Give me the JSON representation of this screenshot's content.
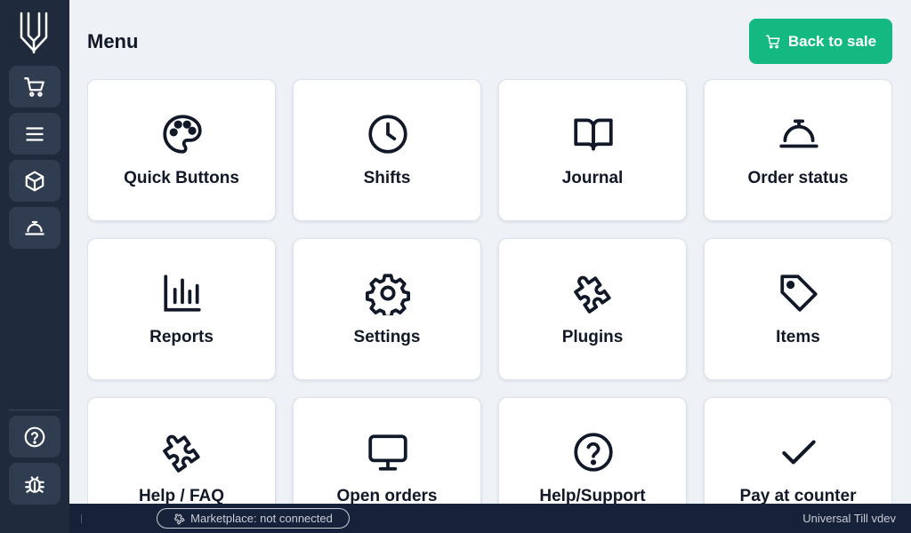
{
  "page": {
    "title": "Menu"
  },
  "header": {
    "back_label": "Back to sale"
  },
  "sidebar": {
    "items": [
      {
        "icon": "cart-icon"
      },
      {
        "icon": "menu-icon"
      },
      {
        "icon": "package-icon"
      },
      {
        "icon": "bell-icon"
      },
      {
        "icon": "help-icon"
      },
      {
        "icon": "bug-icon"
      }
    ]
  },
  "tiles": [
    {
      "label": "Quick Buttons",
      "icon": "palette-icon"
    },
    {
      "label": "Shifts",
      "icon": "clock-icon"
    },
    {
      "label": "Journal",
      "icon": "book-icon"
    },
    {
      "label": "Order status",
      "icon": "bell-icon"
    },
    {
      "label": "Reports",
      "icon": "bar-chart-icon"
    },
    {
      "label": "Settings",
      "icon": "gear-icon"
    },
    {
      "label": "Plugins",
      "icon": "puzzle-icon"
    },
    {
      "label": "Items",
      "icon": "tag-icon"
    },
    {
      "label": "Help / FAQ",
      "icon": "puzzle-icon"
    },
    {
      "label": "Open orders",
      "icon": "monitor-icon"
    },
    {
      "label": "Help/Support",
      "icon": "help-icon"
    },
    {
      "label": "Pay at counter",
      "icon": "check-icon"
    }
  ],
  "status": {
    "marketplace": "Marketplace: not connected",
    "version": "Universal Till vdev"
  },
  "colors": {
    "accent": "#13b981",
    "sidebar": "#1f2a3c",
    "background": "#eef2f7",
    "statusbar": "#16213a"
  }
}
